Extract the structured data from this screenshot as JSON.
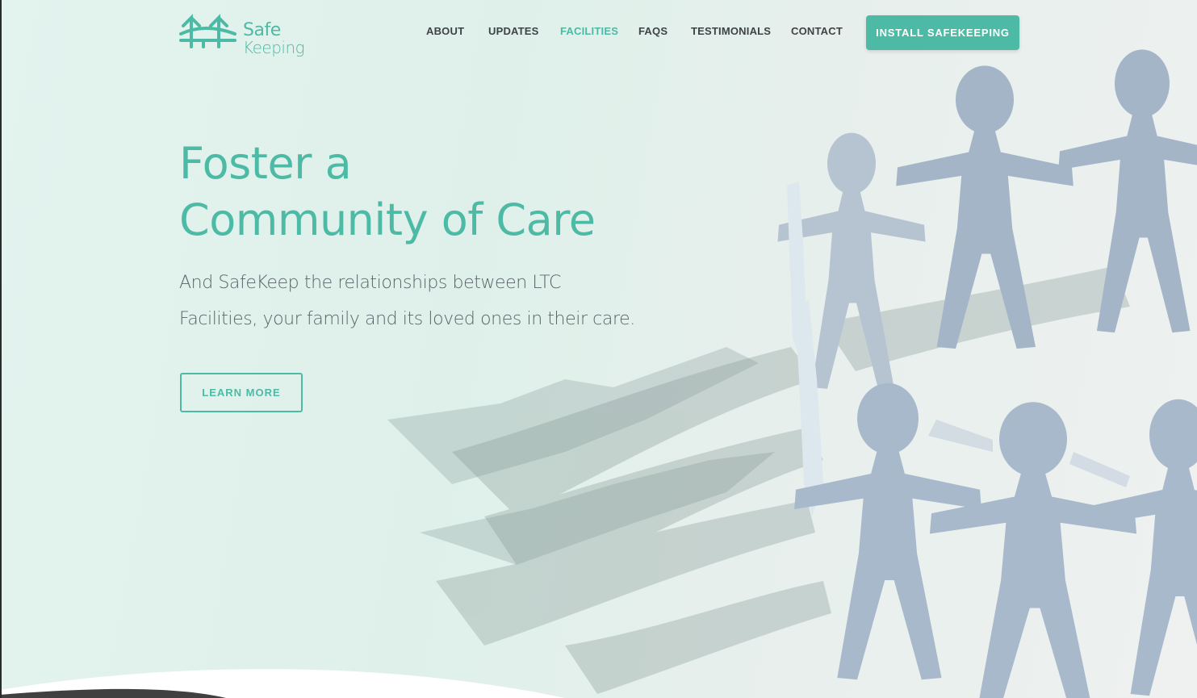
{
  "brand": {
    "name_line1": "Safe",
    "name_line2": "Keeping",
    "accent_color": "#4dbaa5",
    "logo_icon": "bridge-icon"
  },
  "nav": {
    "items": [
      {
        "label": "ABOUT",
        "active": false
      },
      {
        "label": "UPDATES",
        "active": false
      },
      {
        "label": "FACILITIES",
        "active": true
      },
      {
        "label": "FAQS",
        "active": false
      },
      {
        "label": "TESTIMONIALS",
        "active": false
      },
      {
        "label": "CONTACT",
        "active": false
      }
    ],
    "cta_label": "INSTALL SAFEKEEPING"
  },
  "hero": {
    "headline_line1": "Foster a",
    "headline_line2": "Community of Care",
    "subtitle_line1": "And SafeKeep the relationships between LTC",
    "subtitle_line2": "Facilities, your family and its loved ones in their care.",
    "button_label": "LEARN MORE",
    "image_subject": "paper-people-chain-circle"
  }
}
